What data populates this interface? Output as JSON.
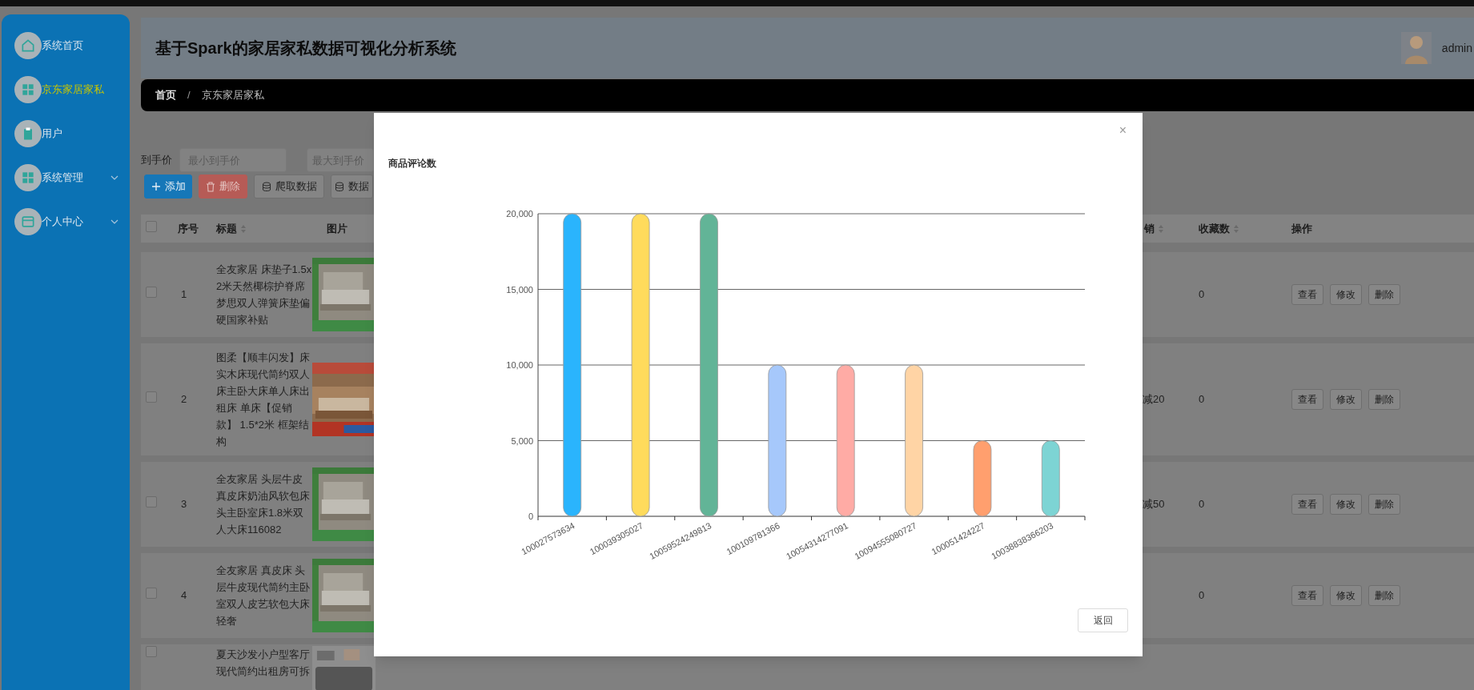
{
  "header": {
    "title": "基于Spark的家居家私数据可视化分析系统",
    "user": "admin"
  },
  "sidebar": {
    "items": [
      {
        "label": "系统首页",
        "selected": false,
        "expandable": false,
        "kind": "home"
      },
      {
        "label": "京东家居家私",
        "selected": true,
        "expandable": false,
        "kind": "grid"
      },
      {
        "label": "用户",
        "selected": false,
        "expandable": false,
        "kind": "clipboard"
      },
      {
        "label": "系统管理",
        "selected": false,
        "expandable": true,
        "kind": "grid"
      },
      {
        "label": "个人中心",
        "selected": false,
        "expandable": true,
        "kind": "card"
      }
    ]
  },
  "breadcrumb": {
    "items": [
      "首页",
      "京东家居家私"
    ],
    "separator": "/"
  },
  "filter": {
    "label": "到手价",
    "fields": [
      {
        "placeholder": "最小到手价"
      },
      {
        "placeholder": "最大到手价"
      }
    ]
  },
  "toolbar": [
    {
      "label": "添加",
      "kind": "primary"
    },
    {
      "label": "删除",
      "kind": "danger"
    },
    {
      "label": "爬取数据",
      "kind": "default"
    },
    {
      "label": "数据",
      "kind": "default"
    }
  ],
  "table": {
    "checked": false,
    "left_columns": [
      {
        "label": "序号",
        "sortable": false
      },
      {
        "label": "标题",
        "sortable": true
      },
      {
        "label": "图片",
        "sortable": false
      }
    ],
    "right_columns": [
      {
        "label": "销",
        "sortable": true
      },
      {
        "label": "收藏数",
        "sortable": true
      },
      {
        "label": "操作",
        "sortable": false
      }
    ],
    "rows": [
      {
        "checked": false,
        "index": "1",
        "title": "全友家居 床垫子1.5x2米天然椰棕护脊席梦思双人弹簧床垫偏硬国家补贴",
        "promo": null,
        "favorites": "0",
        "actions": [
          "查看",
          "修改",
          "删除"
        ]
      },
      {
        "checked": false,
        "index": "2",
        "title": "图柔【顺丰闪发】床实木床现代简约双人床主卧大床单人床出租床 单床【促销款】 1.5*2米 框架结构",
        "promo": "减20",
        "favorites": "0",
        "actions": [
          "查看",
          "修改",
          "删除"
        ]
      },
      {
        "checked": false,
        "index": "3",
        "title": "全友家居 头层牛皮真皮床奶油风软包床头主卧室床1.8米双人大床116082",
        "promo": "减50",
        "favorites": "0",
        "actions": [
          "查看",
          "修改",
          "删除"
        ]
      },
      {
        "checked": false,
        "index": "4",
        "title": "全友家居 真皮床 头层牛皮现代简约主卧室双人皮艺软包大床轻奢",
        "promo": null,
        "favorites": "0",
        "actions": [
          "查看",
          "修改",
          "删除"
        ]
      },
      {
        "checked": false,
        "title": "夏天沙发小户型客厅现代简约出租房可拆"
      }
    ]
  },
  "modal": {
    "button": "返回",
    "close": "×",
    "chart_data": {
      "type": "bar",
      "title": "商品评论数",
      "categories": [
        "100027573634",
        "100039305027",
        "10059524249813",
        "100109781366",
        "10054314277091",
        "10094555080727",
        "100051424227",
        "10038838366203"
      ],
      "grid": true,
      "series": [
        {
          "values": [
            20000,
            20000,
            20000,
            10000,
            10000,
            10000,
            5000,
            5000
          ]
        }
      ],
      "colors": [
        "#2ab4fd",
        "#ffdb5c",
        "#62b497",
        "#a6c8fb",
        "#ffaba5",
        "#ffd4a5",
        "#ff9f6e",
        "#7dd4d4"
      ],
      "ylim": [
        0,
        20000
      ],
      "yticks": [
        {
          "value": 0,
          "label": "0"
        },
        {
          "value": 5000,
          "label": "5,000"
        },
        {
          "value": 10000,
          "label": "10,000"
        },
        {
          "value": 15000,
          "label": "15,000"
        },
        {
          "value": 20000,
          "label": "20,000"
        }
      ]
    }
  }
}
